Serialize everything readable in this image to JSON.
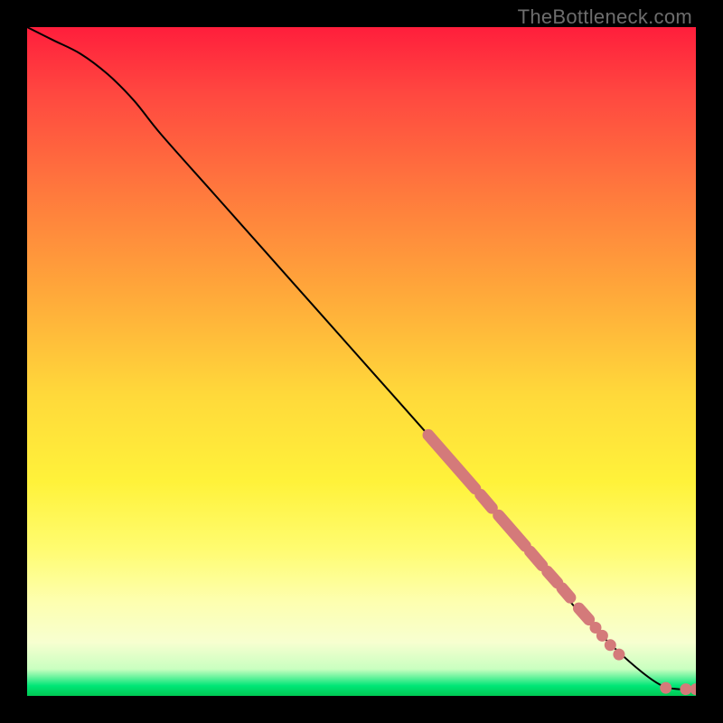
{
  "watermark": "TheBottleneck.com",
  "chart_data": {
    "type": "line",
    "title": "",
    "xlabel": "",
    "ylabel": "",
    "xlim": [
      0,
      100
    ],
    "ylim": [
      0,
      100
    ],
    "grid": false,
    "legend": false,
    "background": "gradient_red_to_green",
    "series": [
      {
        "name": "curve",
        "kind": "line",
        "x": [
          0,
          4,
          8,
          12,
          16,
          20,
          28,
          36,
          44,
          52,
          60,
          66,
          72,
          78,
          83,
          88,
          92,
          95,
          97.5,
          100
        ],
        "y": [
          100,
          98,
          96,
          93,
          89,
          84,
          75,
          66,
          57,
          48,
          39,
          32,
          25,
          18,
          12,
          7,
          3.5,
          1.5,
          1.0,
          1.0
        ]
      },
      {
        "name": "highlight-segments",
        "kind": "thick_line_segments",
        "color": "#d47a7a",
        "segments": [
          {
            "x": [
              60.0,
              67.0
            ],
            "y": [
              39.0,
              31.0
            ]
          },
          {
            "x": [
              67.8,
              69.5
            ],
            "y": [
              30.1,
              28.1
            ]
          },
          {
            "x": [
              70.5,
              74.5
            ],
            "y": [
              27.0,
              22.4
            ]
          },
          {
            "x": [
              75.2,
              77.0
            ],
            "y": [
              21.6,
              19.5
            ]
          },
          {
            "x": [
              77.8,
              79.3
            ],
            "y": [
              18.6,
              16.9
            ]
          },
          {
            "x": [
              80.0,
              81.2
            ],
            "y": [
              16.1,
              14.7
            ]
          },
          {
            "x": [
              82.5,
              84.0
            ],
            "y": [
              13.1,
              11.4
            ]
          }
        ]
      },
      {
        "name": "highlight-points",
        "kind": "scatter",
        "color": "#d47a7a",
        "x": [
          85.0,
          86.0,
          87.2,
          88.5,
          95.5,
          98.5,
          100.0
        ],
        "y": [
          10.2,
          9.0,
          7.6,
          6.2,
          1.2,
          1.0,
          1.0
        ]
      }
    ]
  }
}
